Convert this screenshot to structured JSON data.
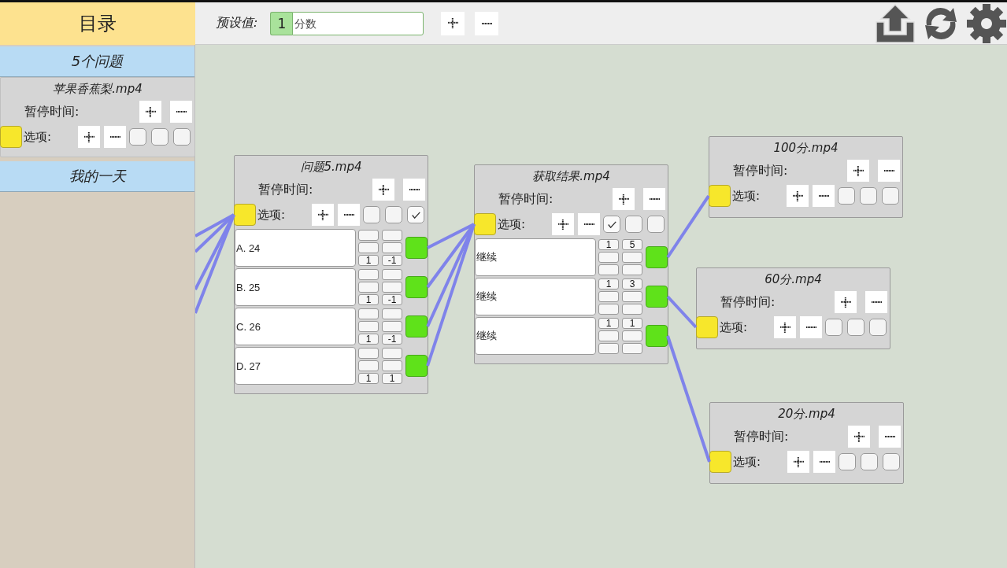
{
  "sidebar": {
    "title": "目录",
    "groups": [
      {
        "title": "5个问题",
        "nodes": [
          {
            "title": "苹果香蕉梨.mp4",
            "pause_label": "暂停时间:",
            "options_label": "选项:",
            "checks": [
              false,
              false,
              false
            ]
          }
        ]
      },
      {
        "title": "我的一天"
      }
    ]
  },
  "toolbar": {
    "label": "预设值:",
    "value": "1",
    "placeholder": "分数"
  },
  "nodes": [
    {
      "title": "问题5.mp4",
      "pause_label": "暂停时间:",
      "options_label": "选项:",
      "checks": [
        false,
        false,
        true
      ],
      "options": [
        {
          "text": "A. 24",
          "bottom_values": [
            "1",
            "-1"
          ]
        },
        {
          "text": "B. 25",
          "bottom_values": [
            "1",
            "-1"
          ]
        },
        {
          "text": "C. 26",
          "bottom_values": [
            "1",
            "-1"
          ]
        },
        {
          "text": "D. 27",
          "bottom_values": [
            "1",
            "1"
          ]
        }
      ]
    },
    {
      "title": "获取结果.mp4",
      "pause_label": "暂停时间:",
      "options_label": "选项:",
      "checks": [
        true,
        false,
        false
      ],
      "options": [
        {
          "text": "继续",
          "top_values": [
            "1",
            "5"
          ]
        },
        {
          "text": "继续",
          "top_values": [
            "1",
            "3"
          ]
        },
        {
          "text": "继续",
          "top_values": [
            "1",
            "1"
          ]
        }
      ]
    },
    {
      "title": "100分.mp4",
      "pause_label": "暂停时间:",
      "options_label": "选项:",
      "checks": [
        false,
        false,
        false
      ]
    },
    {
      "title": "60分.mp4",
      "pause_label": "暂停时间:",
      "options_label": "选项:",
      "checks": [
        false,
        false,
        false
      ]
    },
    {
      "title": "20分.mp4",
      "pause_label": "暂停时间:",
      "options_label": "选项:",
      "checks": [
        false,
        false,
        false
      ]
    }
  ]
}
